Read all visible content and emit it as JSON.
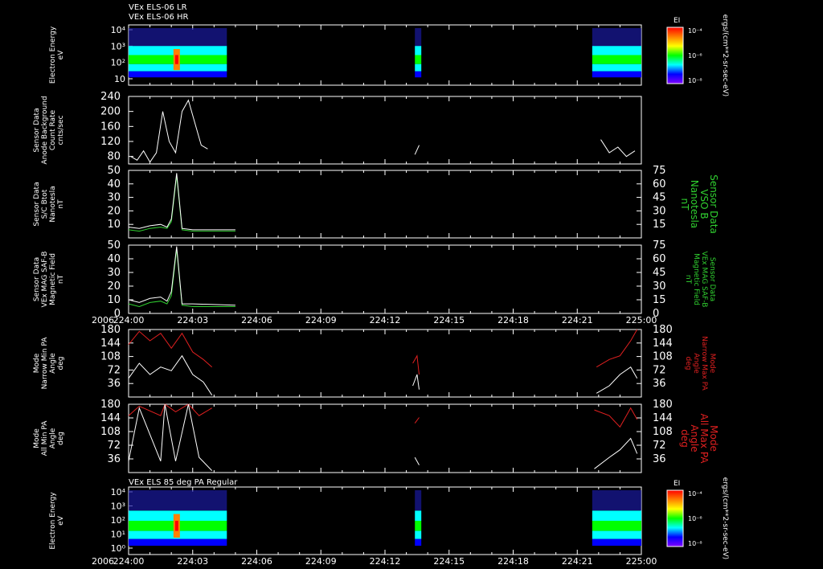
{
  "header": {
    "line1": "VEx ELS-06 LR",
    "line2": "VEx ELS-06 HR",
    "bottom_title": "VEx ELS 85 deg PA Regular",
    "year": "2006"
  },
  "time_ticks": [
    "224:00",
    "224:03",
    "224:06",
    "224:09",
    "224:12",
    "224:15",
    "224:18",
    "224:21",
    "225:00"
  ],
  "colorbar": {
    "label": "EI",
    "units": "ergs/(cm**2-sr-sec-eV)",
    "ticks": [
      "10⁻⁴",
      "10⁻⁶",
      "10⁻⁸"
    ],
    "colors": [
      "#ff0000",
      "#ff8000",
      "#ffff00",
      "#00ff00",
      "#00ffff",
      "#0000ff",
      "#8000ff"
    ]
  },
  "panels": [
    {
      "id": "spec1",
      "kind": "spectrogram",
      "ylabel": [
        "Electron Energy",
        "eV"
      ],
      "yticks": [
        "10⁴",
        "10³",
        "10²",
        "10"
      ]
    },
    {
      "id": "count",
      "kind": "line",
      "ylabel": [
        "Sensor Data",
        "Anode Background",
        "Count Rate",
        "cnts/sec"
      ],
      "ylim": [
        60,
        240
      ],
      "yticks": [
        80,
        120,
        160,
        200,
        240
      ]
    },
    {
      "id": "vsob",
      "kind": "line",
      "ylabel": [
        "Sensor Data",
        "S/C Btot",
        "Nanotesla",
        "nT"
      ],
      "ylim": [
        0,
        50
      ],
      "yticks": [
        10,
        20,
        30,
        40,
        50
      ],
      "right_ticks": [
        15,
        30,
        45,
        60,
        75
      ],
      "right_label": [
        "Sensor Data",
        "VSO B",
        "Nanotesla",
        "nT"
      ]
    },
    {
      "id": "mag",
      "kind": "line",
      "ylabel": [
        "Sensor Data",
        "VEx MAG SAF-B",
        "Magnetic Field",
        "nT"
      ],
      "ylim": [
        0,
        50
      ],
      "yticks": [
        0,
        10,
        20,
        30,
        40,
        50
      ],
      "right_ticks": [
        0,
        15,
        30,
        45,
        60,
        75
      ],
      "right_label": [
        "Sensor Data",
        "VEx MAG SAF-B",
        "Magnetic Field",
        "nT"
      ]
    },
    {
      "id": "narrow",
      "kind": "line",
      "ylabel": [
        "Mode",
        "Narrow Min PA",
        "Angle",
        "deg"
      ],
      "ylim": [
        0,
        180
      ],
      "yticks": [
        36,
        72,
        108,
        144,
        180
      ],
      "right_ticks": [
        36,
        72,
        108,
        144,
        180
      ],
      "right_label": [
        "Mode",
        "Narrow Max PA",
        "Angle",
        "deg"
      ]
    },
    {
      "id": "all",
      "kind": "line",
      "ylabel": [
        "Mode",
        "All Min PA",
        "Angle",
        "deg"
      ],
      "ylim": [
        0,
        180
      ],
      "yticks": [
        36,
        72,
        108,
        144,
        180
      ],
      "right_ticks": [
        36,
        72,
        108,
        144,
        180
      ],
      "right_label": [
        "Mode",
        "All Max PA",
        "Angle",
        "deg"
      ]
    },
    {
      "id": "spec2",
      "kind": "spectrogram",
      "ylabel": [
        "Electron Energy",
        "eV"
      ],
      "yticks": [
        "10⁴",
        "10³",
        "10²",
        "10¹",
        "10⁰"
      ]
    }
  ],
  "chart_data": {
    "type": "line",
    "x_unit": "minutes after 224:00",
    "xlim": [
      0,
      24
    ],
    "count_rate": [
      [
        0.1,
        80
      ],
      [
        0.4,
        70
      ],
      [
        0.7,
        95
      ],
      [
        1.0,
        65
      ],
      [
        1.3,
        90
      ],
      [
        1.6,
        200
      ],
      [
        1.9,
        120
      ],
      [
        2.2,
        90
      ],
      [
        2.5,
        200
      ],
      [
        2.8,
        230
      ],
      [
        3.1,
        170
      ],
      [
        3.4,
        110
      ],
      [
        3.7,
        100
      ],
      [
        13.4,
        85
      ],
      [
        13.6,
        110
      ],
      [
        22.1,
        125
      ],
      [
        22.5,
        90
      ],
      [
        22.9,
        105
      ],
      [
        23.3,
        80
      ],
      [
        23.7,
        95
      ]
    ],
    "btot_nT": [
      [
        0.0,
        8
      ],
      [
        0.5,
        7
      ],
      [
        1.0,
        9
      ],
      [
        1.5,
        10
      ],
      [
        1.8,
        8
      ],
      [
        2.0,
        14
      ],
      [
        2.25,
        48
      ],
      [
        2.5,
        7
      ],
      [
        3.0,
        6
      ],
      [
        5.0,
        6
      ],
      [
        10.0,
        6
      ],
      [
        15.0,
        6
      ],
      [
        20.0,
        5
      ],
      [
        24.0,
        4
      ]
    ],
    "vso_b": [
      [
        0.0,
        6
      ],
      [
        0.5,
        5
      ],
      [
        1.0,
        7
      ],
      [
        1.5,
        8
      ],
      [
        1.8,
        7
      ],
      [
        2.0,
        12
      ],
      [
        2.25,
        46
      ],
      [
        2.5,
        6
      ],
      [
        3.0,
        5
      ],
      [
        5.0,
        5
      ],
      [
        10.0,
        5
      ],
      [
        15.0,
        5
      ],
      [
        20.0,
        4
      ],
      [
        24.0,
        3
      ]
    ],
    "mag_b_nT": [
      [
        0.0,
        10
      ],
      [
        0.5,
        8
      ],
      [
        1.0,
        11
      ],
      [
        1.5,
        12
      ],
      [
        1.8,
        9
      ],
      [
        2.0,
        16
      ],
      [
        2.25,
        49
      ],
      [
        2.5,
        7
      ],
      [
        3.0,
        7
      ],
      [
        5.0,
        6
      ],
      [
        10.0,
        6
      ],
      [
        15.0,
        6
      ],
      [
        20.0,
        5
      ],
      [
        24.0,
        4
      ]
    ],
    "mag_b_green": [
      [
        0.0,
        7
      ],
      [
        0.5,
        5
      ],
      [
        1.0,
        8
      ],
      [
        1.5,
        9
      ],
      [
        1.8,
        7
      ],
      [
        2.0,
        13
      ],
      [
        2.25,
        47
      ],
      [
        2.5,
        6
      ],
      [
        3.0,
        5
      ],
      [
        5.0,
        5
      ],
      [
        10.0,
        5
      ],
      [
        15.0,
        5
      ],
      [
        20.0,
        4
      ],
      [
        24.0,
        3
      ]
    ],
    "narrow_min_pa": [
      [
        0.0,
        50
      ],
      [
        0.5,
        90
      ],
      [
        1.0,
        60
      ],
      [
        1.5,
        80
      ],
      [
        2.0,
        70
      ],
      [
        2.5,
        110
      ],
      [
        3.0,
        60
      ],
      [
        3.5,
        40
      ],
      [
        3.9,
        5
      ],
      [
        13.3,
        30
      ],
      [
        13.5,
        60
      ],
      [
        13.6,
        20
      ],
      [
        21.9,
        10
      ],
      [
        22.5,
        30
      ],
      [
        23.0,
        60
      ],
      [
        23.5,
        80
      ],
      [
        23.8,
        50
      ]
    ],
    "narrow_max_pa": [
      [
        0.0,
        140
      ],
      [
        0.5,
        175
      ],
      [
        1.0,
        150
      ],
      [
        1.5,
        170
      ],
      [
        2.0,
        130
      ],
      [
        2.5,
        170
      ],
      [
        3.0,
        120
      ],
      [
        3.5,
        100
      ],
      [
        3.9,
        80
      ],
      [
        13.3,
        90
      ],
      [
        13.5,
        110
      ],
      [
        13.6,
        60
      ],
      [
        21.9,
        80
      ],
      [
        22.5,
        100
      ],
      [
        23.0,
        110
      ],
      [
        23.5,
        150
      ],
      [
        23.8,
        180
      ]
    ],
    "all_min_pa": [
      [
        0.0,
        30
      ],
      [
        0.5,
        170
      ],
      [
        1.5,
        30
      ],
      [
        1.7,
        180
      ],
      [
        2.2,
        30
      ],
      [
        2.8,
        180
      ],
      [
        3.3,
        40
      ],
      [
        3.9,
        5
      ],
      [
        13.4,
        40
      ],
      [
        13.6,
        20
      ],
      [
        21.8,
        10
      ],
      [
        22.5,
        40
      ],
      [
        23.0,
        60
      ],
      [
        23.5,
        90
      ],
      [
        23.8,
        50
      ]
    ],
    "all_max_pa": [
      [
        0.0,
        150
      ],
      [
        0.5,
        175
      ],
      [
        1.5,
        150
      ],
      [
        1.7,
        180
      ],
      [
        2.2,
        160
      ],
      [
        2.8,
        180
      ],
      [
        3.3,
        150
      ],
      [
        3.9,
        170
      ],
      [
        13.4,
        130
      ],
      [
        13.6,
        145
      ],
      [
        21.8,
        165
      ],
      [
        22.5,
        150
      ],
      [
        23.0,
        120
      ],
      [
        23.5,
        170
      ],
      [
        23.8,
        140
      ]
    ]
  }
}
